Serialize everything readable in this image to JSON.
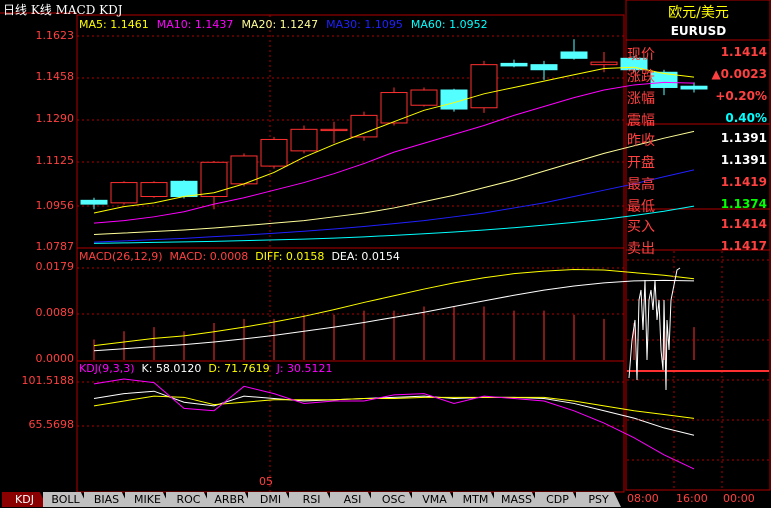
{
  "header": {
    "title": "日线 K线 MACD KDJ"
  },
  "ma_legend": [
    {
      "text": "MA5: 1.1461",
      "color": "#ffff00"
    },
    {
      "text": "MA10: 1.1437",
      "color": "#ff00ff"
    },
    {
      "text": "MA20: 1.1247",
      "color": "#ffff99"
    },
    {
      "text": "MA30: 1.1095",
      "color": "#2020ff"
    },
    {
      "text": "MA60: 1.0952",
      "color": "#00ffff"
    }
  ],
  "macd_legend": [
    {
      "text": "MACD(26,12,9)",
      "color": "#ff4040"
    },
    {
      "text": "MACD: 0.0008",
      "color": "#ff4040"
    },
    {
      "text": "DIFF: 0.0158",
      "color": "#ffff00"
    },
    {
      "text": "DEA: 0.0154",
      "color": "#ffffff"
    }
  ],
  "kdj_legend": [
    {
      "text": "KDJ(9,3,3)",
      "color": "#ff00ff"
    },
    {
      "text": "K: 58.0120",
      "color": "#ffffff"
    },
    {
      "text": "D: 71.7619",
      "color": "#ffff00"
    },
    {
      "text": "J: 30.5121",
      "color": "#ff00ff"
    }
  ],
  "price_axis": [
    "1.1623",
    "1.1458",
    "1.1290",
    "1.1125",
    "1.0956",
    "1.0787"
  ],
  "macd_axis": [
    "0.0179",
    "0.0089",
    "0.0000"
  ],
  "kdj_axis": [
    "101.5188",
    "65.5698"
  ],
  "x_label": "05",
  "quote": {
    "name": "欧元/美元",
    "symbol": "EURUSD",
    "rows": [
      {
        "label": "现价",
        "value": "1.1414",
        "color": "#ff4040"
      },
      {
        "label": "涨跌",
        "value": "▲0.0023",
        "color": "#ff4040"
      },
      {
        "label": "涨幅",
        "value": "+0.20%",
        "color": "#ff4040"
      },
      {
        "label": "震幅",
        "value": "0.40%",
        "color": "#00ffff"
      },
      {
        "label": "昨收",
        "value": "1.1391",
        "color": "#ffffff"
      },
      {
        "label": "开盘",
        "value": "1.1391",
        "color": "#ffffff"
      },
      {
        "label": "最高",
        "value": "1.1419",
        "color": "#ff4040"
      },
      {
        "label": "最低",
        "value": "1.1374",
        "color": "#00ff00"
      },
      {
        "label": "买入",
        "value": "1.1414",
        "color": "#ff4040"
      },
      {
        "label": "卖出",
        "value": "1.1417",
        "color": "#ff4040"
      }
    ]
  },
  "intraday_axis": [
    "08:00",
    "16:00",
    "00:00"
  ],
  "tabs": [
    "KDJ",
    "BOLL",
    "BIAS",
    "MIKE",
    "ROC",
    "ARBR",
    "DMI",
    "RSI",
    "ASI",
    "OSC",
    "VMA",
    "MTM",
    "MASS",
    "CDP",
    "PSY"
  ],
  "active_tab": "KDJ",
  "colors": {
    "frame": "#b00000",
    "up": "#ff3030",
    "down": "#54ffff"
  },
  "chart_data": [
    {
      "type": "candlestick",
      "title": "EURUSD 日线",
      "ylim": [
        1.0787,
        1.1623
      ],
      "candles": [
        {
          "open": 1.0975,
          "close": 1.096,
          "high": 1.0985,
          "low": 1.094
        },
        {
          "open": 1.0965,
          "close": 1.1045,
          "high": 1.105,
          "low": 1.0958
        },
        {
          "open": 1.099,
          "close": 1.1045,
          "high": 1.105,
          "low": 1.0985
        },
        {
          "open": 1.105,
          "close": 1.099,
          "high": 1.1055,
          "low": 1.0982
        },
        {
          "open": 1.099,
          "close": 1.1125,
          "high": 1.113,
          "low": 1.094
        },
        {
          "open": 1.104,
          "close": 1.115,
          "high": 1.116,
          "low": 1.103
        },
        {
          "open": 1.111,
          "close": 1.1215,
          "high": 1.1225,
          "low": 1.11
        },
        {
          "open": 1.117,
          "close": 1.1255,
          "high": 1.127,
          "low": 1.116
        },
        {
          "open": 1.125,
          "close": 1.1255,
          "high": 1.1285,
          "low": 1.12
        },
        {
          "open": 1.1225,
          "close": 1.131,
          "high": 1.1325,
          "low": 1.121
        },
        {
          "open": 1.128,
          "close": 1.14,
          "high": 1.142,
          "low": 1.127
        },
        {
          "open": 1.135,
          "close": 1.141,
          "high": 1.142,
          "low": 1.1345
        },
        {
          "open": 1.141,
          "close": 1.1335,
          "high": 1.1415,
          "low": 1.1325
        },
        {
          "open": 1.134,
          "close": 1.151,
          "high": 1.1525,
          "low": 1.132
        },
        {
          "open": 1.1515,
          "close": 1.1505,
          "high": 1.153,
          "low": 1.15
        },
        {
          "open": 1.151,
          "close": 1.149,
          "high": 1.1525,
          "low": 1.145
        },
        {
          "open": 1.156,
          "close": 1.1535,
          "high": 1.161,
          "low": 1.153
        },
        {
          "open": 1.151,
          "close": 1.152,
          "high": 1.156,
          "low": 1.148
        },
        {
          "open": 1.1535,
          "close": 1.149,
          "high": 1.1545,
          "low": 1.148
        },
        {
          "open": 1.148,
          "close": 1.142,
          "high": 1.149,
          "low": 1.139
        },
        {
          "open": 1.1425,
          "close": 1.1414,
          "high": 1.144,
          "low": 1.14
        }
      ],
      "ma_lines": [
        {
          "name": "MA5",
          "color": "#ffff00",
          "values": [
            1.0925,
            1.095,
            1.0965,
            1.099,
            1.1005,
            1.104,
            1.1085,
            1.1145,
            1.1195,
            1.124,
            1.1285,
            1.133,
            1.136,
            1.1395,
            1.142,
            1.1445,
            1.147,
            1.1495,
            1.15,
            1.1475,
            1.1461
          ]
        },
        {
          "name": "MA10",
          "color": "#ff00ff",
          "values": [
            1.0885,
            1.0895,
            1.091,
            1.093,
            1.096,
            1.0985,
            1.1015,
            1.1045,
            1.108,
            1.112,
            1.1165,
            1.12,
            1.1235,
            1.127,
            1.131,
            1.1345,
            1.138,
            1.141,
            1.143,
            1.144,
            1.1437
          ]
        },
        {
          "name": "MA20",
          "color": "#ffff99",
          "values": [
            1.084,
            1.0846,
            1.0852,
            1.0858,
            1.0866,
            1.0875,
            1.0885,
            1.0895,
            1.091,
            1.0925,
            1.0945,
            1.097,
            1.0995,
            1.1025,
            1.1055,
            1.109,
            1.1125,
            1.116,
            1.119,
            1.122,
            1.1247
          ]
        },
        {
          "name": "MA30",
          "color": "#2020ff",
          "values": [
            1.081,
            1.0815,
            1.082,
            1.0825,
            1.0832,
            1.0838,
            1.0845,
            1.0853,
            1.0862,
            1.0872,
            1.0883,
            1.0895,
            1.091,
            1.0925,
            1.0945,
            1.0965,
            1.099,
            1.1015,
            1.104,
            1.1068,
            1.1095
          ]
        },
        {
          "name": "MA60",
          "color": "#00ffff",
          "values": [
            1.0805,
            1.0807,
            1.0809,
            1.0811,
            1.0813,
            1.0816,
            1.0819,
            1.0822,
            1.0826,
            1.0831,
            1.0837,
            1.0843,
            1.085,
            1.0858,
            1.0867,
            1.0877,
            1.0888,
            1.09,
            1.0915,
            1.0932,
            1.0952
          ]
        }
      ]
    },
    {
      "type": "bar",
      "title": "MACD(26,12,9)",
      "ylim": [
        0,
        0.0179
      ],
      "macd_bars": [
        0.0005,
        0.0007,
        0.0008,
        0.0007,
        0.0009,
        0.001,
        0.001,
        0.0011,
        0.0011,
        0.0012,
        0.0012,
        0.0013,
        0.0013,
        0.0013,
        0.0012,
        0.0012,
        0.0011,
        0.001,
        0.0009,
        0.0007,
        0.0008
      ],
      "series": [
        {
          "name": "DIFF",
          "color": "#ffff00",
          "values": [
            0.0028,
            0.0035,
            0.0042,
            0.0047,
            0.0055,
            0.0064,
            0.0074,
            0.0085,
            0.0098,
            0.0112,
            0.0125,
            0.0138,
            0.015,
            0.016,
            0.0168,
            0.0173,
            0.0176,
            0.0175,
            0.017,
            0.0165,
            0.0158
          ]
        },
        {
          "name": "DEA",
          "color": "#ffffff",
          "values": [
            0.0018,
            0.0022,
            0.0026,
            0.003,
            0.0035,
            0.0041,
            0.0048,
            0.0056,
            0.0064,
            0.0073,
            0.0083,
            0.0093,
            0.0104,
            0.0115,
            0.0126,
            0.0136,
            0.0144,
            0.015,
            0.0154,
            0.0155,
            0.0154
          ]
        }
      ]
    },
    {
      "type": "line",
      "title": "KDJ(9,3,3)",
      "ylim": [
        30,
        101.5188
      ],
      "series": [
        {
          "name": "K",
          "color": "#ffffff",
          "values": [
            88,
            92,
            94,
            85,
            82,
            90,
            88,
            86,
            87,
            88,
            89,
            90,
            88,
            89,
            89,
            88,
            84,
            78,
            72,
            64,
            58
          ]
        },
        {
          "name": "D",
          "color": "#ffff00",
          "values": [
            82,
            86,
            90,
            89,
            83,
            85,
            87,
            87,
            87,
            88,
            88,
            89,
            89,
            89,
            89,
            89,
            86,
            82,
            78,
            75,
            71.76
          ]
        },
        {
          "name": "J",
          "color": "#ff00ff",
          "values": [
            100,
            104,
            101,
            80,
            78,
            98,
            92,
            84,
            86,
            86,
            91,
            92,
            84,
            90,
            88,
            86,
            78,
            68,
            56,
            42,
            30.51
          ]
        }
      ]
    }
  ]
}
